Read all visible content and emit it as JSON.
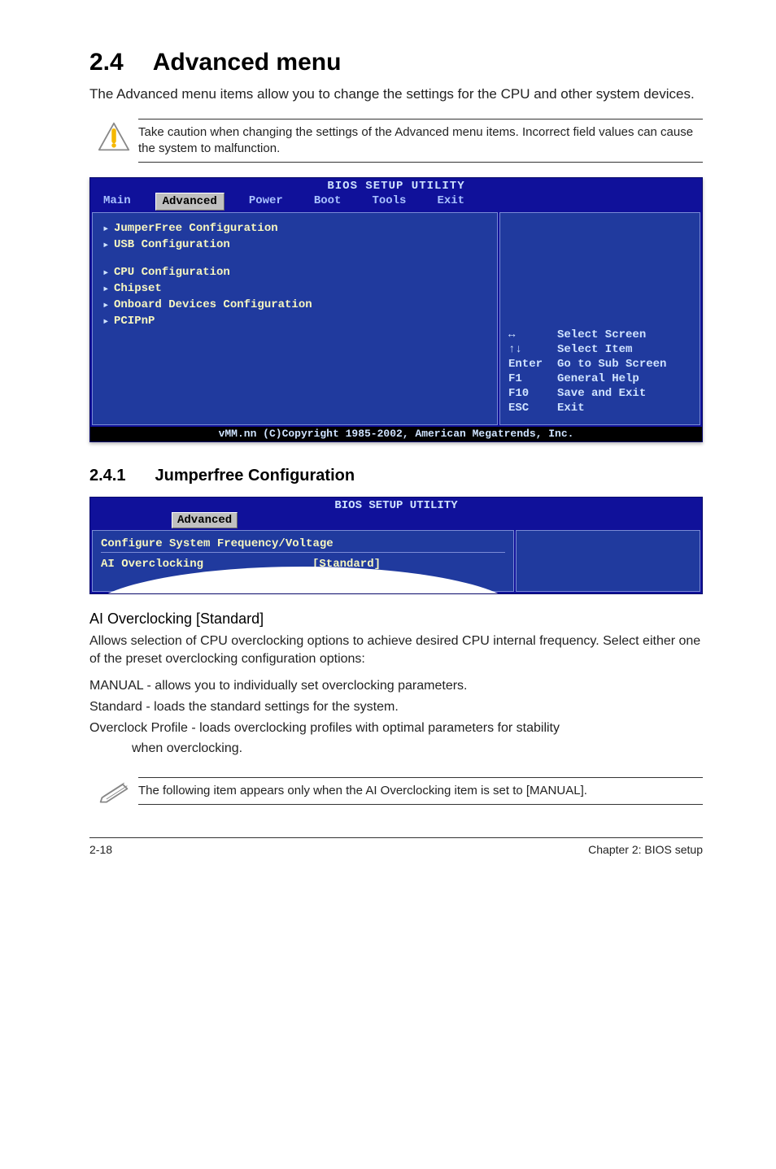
{
  "heading": {
    "number": "2.4",
    "title": "Advanced menu"
  },
  "intro": "The Advanced menu items allow you to change the settings for the CPU and other system devices.",
  "warning": "Take caution when changing the settings of the Advanced menu items. Incorrect field values can cause the system to malfunction.",
  "bios1": {
    "title": "BIOS SETUP UTILITY",
    "tabs": [
      "Main",
      "Advanced",
      "Power",
      "Boot",
      "Tools",
      "Exit"
    ],
    "selected_tab_index": 1,
    "menu_items": [
      "JumperFree Configuration",
      "USB Configuration",
      "",
      "CPU Configuration",
      "Chipset",
      "Onboard Devices Configuration",
      "PCIPnP"
    ],
    "legend": [
      {
        "key": "↔",
        "text": "Select Screen"
      },
      {
        "key": "↑↓",
        "text": "Select Item"
      },
      {
        "key": "Enter",
        "text": "Go to Sub Screen"
      },
      {
        "key": "F1",
        "text": "General Help"
      },
      {
        "key": "F10",
        "text": "Save and Exit"
      },
      {
        "key": "ESC",
        "text": "Exit"
      }
    ],
    "footer": "vMM.nn (C)Copyright 1985-2002, American Megatrends, Inc."
  },
  "subheading": {
    "number": "2.4.1",
    "title": "Jumperfree Configuration"
  },
  "bios2": {
    "title": "BIOS SETUP UTILITY",
    "tab": "Advanced",
    "panel_heading": "Configure System Frequency/Voltage",
    "option_label": "AI Overclocking",
    "option_value": "[Standard]"
  },
  "ai_overclocking": {
    "heading": "AI Overclocking [Standard]",
    "desc": "Allows selection of CPU overclocking options to achieve desired CPU internal frequency. Select either one of the preset overclocking configuration options:",
    "manual": "MANUAL - allows you to individually set overclocking parameters.",
    "standard": "Standard - loads the standard settings for the system.",
    "overclock_l1": "Overclock Profile - loads overclocking profiles with optimal parameters for stability",
    "overclock_l2": "when overclocking."
  },
  "note": "The following item appears only when the AI Overclocking item is set to [MANUAL].",
  "footer": {
    "left": "2-18",
    "right": "Chapter 2: BIOS setup"
  }
}
